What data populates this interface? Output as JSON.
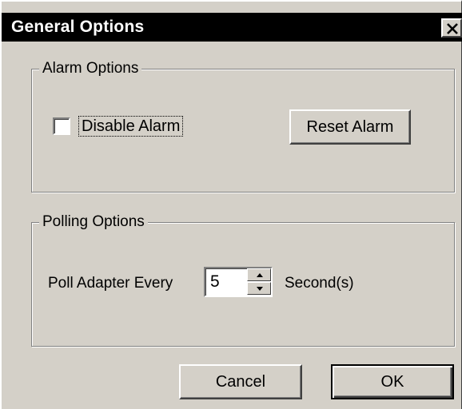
{
  "window": {
    "title": "General Options",
    "close_icon": "close-icon"
  },
  "alarm_options": {
    "legend": "Alarm Options",
    "disable_alarm_label": "Disable Alarm",
    "disable_alarm_checked": false,
    "reset_alarm_label": "Reset Alarm"
  },
  "polling_options": {
    "legend": "Polling Options",
    "poll_label": "Poll Adapter Every",
    "poll_value": "5",
    "unit_label": "Second(s)",
    "spin_up_icon": "arrow-up-icon",
    "spin_down_icon": "arrow-down-icon"
  },
  "buttons": {
    "cancel_label": "Cancel",
    "ok_label": "OK"
  },
  "colors": {
    "face": "#d4d0c8",
    "titlebar": "#000000",
    "title_text": "#ffffff"
  }
}
